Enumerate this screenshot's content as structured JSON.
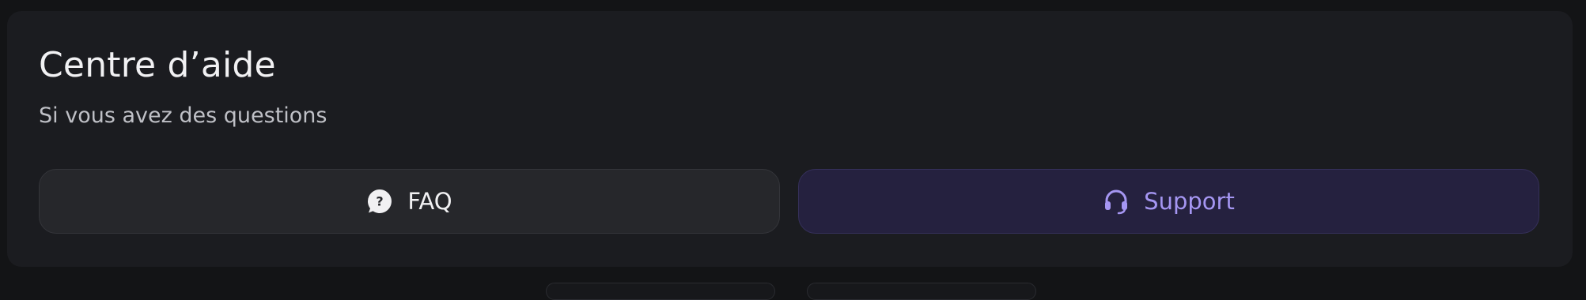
{
  "help_center": {
    "title": "Centre d’aide",
    "subtitle": "Si vous avez des questions",
    "faq_button": {
      "label": "FAQ",
      "icon": "question-bubble-icon"
    },
    "support_button": {
      "label": "Support",
      "icon": "headset-icon"
    }
  },
  "colors": {
    "page_background": "#131416",
    "card_background": "#1b1c20",
    "faq_background": "#26272b",
    "support_background": "#25213f",
    "support_accent": "#a596f2"
  }
}
